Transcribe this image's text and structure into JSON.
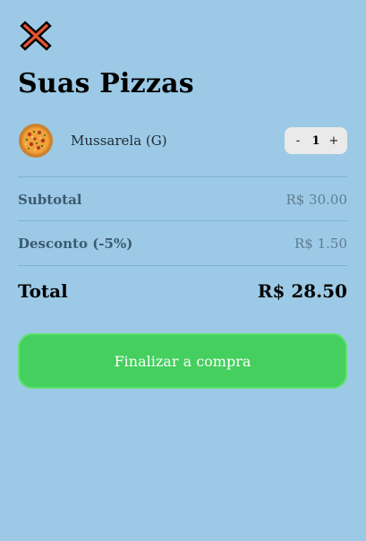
{
  "header": {
    "close_icon": "close-x-icon",
    "title": "Suas Pizzas"
  },
  "cart": {
    "items": [
      {
        "name": "Mussarela (G)",
        "image_icon": "pizza-icon",
        "quantity": "1",
        "decrement_label": "-",
        "increment_label": "+"
      }
    ]
  },
  "summary": {
    "subtotal_label": "Subtotal",
    "subtotal_value": "R$ 30.00",
    "discount_label": "Desconto (-5%)",
    "discount_value": "R$ 1.50",
    "total_label": "Total",
    "total_value": "R$ 28.50"
  },
  "checkout": {
    "button_label": "Finalizar a compra"
  },
  "colors": {
    "background": "#9ccae6",
    "checkout_button": "#44cf5e",
    "close_icon_fill": "#e8552e"
  }
}
